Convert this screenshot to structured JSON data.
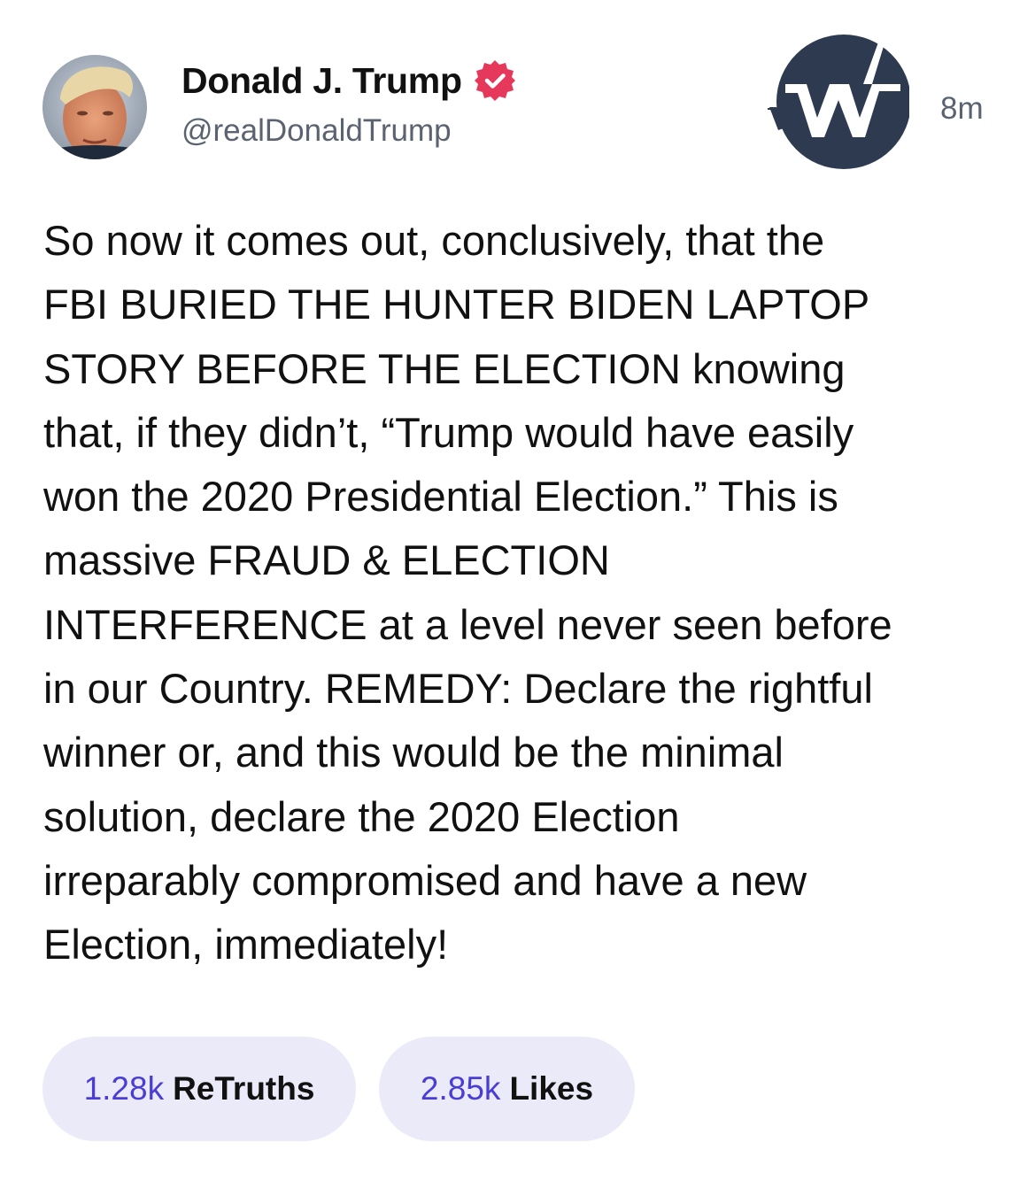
{
  "post": {
    "author": {
      "display_name": "Donald J. Trump",
      "handle": "@realDonaldTrump",
      "verified_icon": "verified-badge-icon",
      "avatar_icon": "profile-avatar"
    },
    "logo_icon": "truth-social-w-logo",
    "timestamp": "8m",
    "body_lines": [
      "So now it comes out, conclusively, that the",
      "FBI BURIED THE HUNTER BIDEN LAPTOP",
      "STORY BEFORE THE ELECTION knowing",
      "that, if they didn’t, “Trump would have easily",
      "won the 2020 Presidential Election.” This is",
      "massive FRAUD & ELECTION",
      "INTERFERENCE at a level never seen before",
      "in our Country. REMEDY: Declare the rightful",
      "winner or, and this would be the minimal",
      "solution, declare the 2020 Election",
      "irreparably compromised and have a new",
      "Election, immediately!"
    ],
    "stats": {
      "retruths_count": "1.28k",
      "retruths_label": "ReTruths",
      "likes_count": "2.85k",
      "likes_label": "Likes"
    }
  },
  "colors": {
    "accent": "#4a3dd6",
    "pill_background": "#ebeaf8",
    "verified_badge": "#e5385a",
    "logo_background": "#2d3a4f",
    "secondary_text": "#5b6270"
  }
}
